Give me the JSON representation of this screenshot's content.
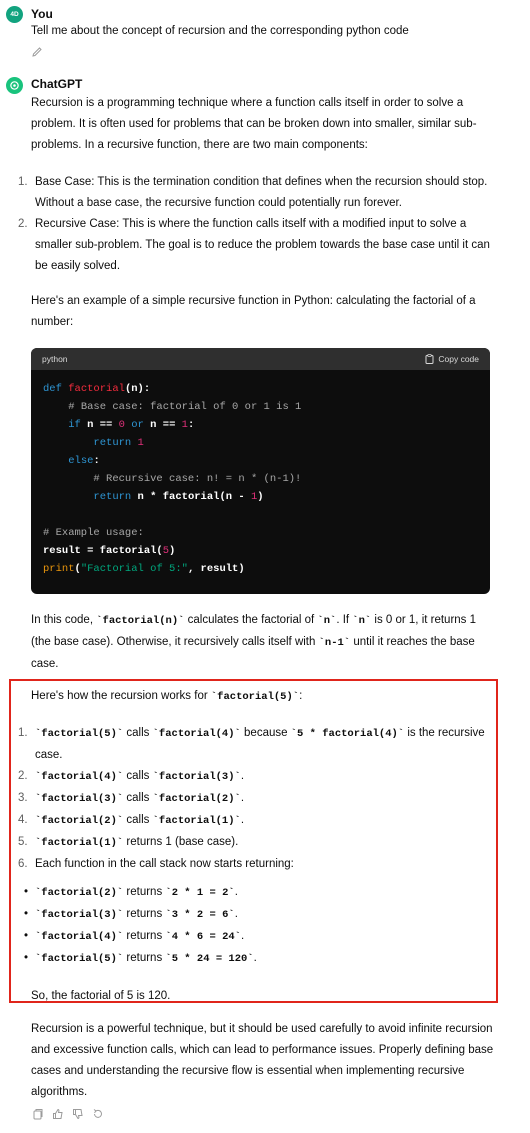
{
  "user": {
    "avatar_text": "4D",
    "name": "You",
    "message": "Tell me about the concept of recursion and the corresponding python code"
  },
  "assistant": {
    "name": "ChatGPT",
    "intro": "Recursion is a programming technique where a function calls itself in order to solve a problem. It is often used for problems that can be broken down into smaller, similar sub-problems. In a recursive function, there are two main components:",
    "components": [
      {
        "num": "1.",
        "text": "Base Case: This is the termination condition that defines when the recursion should stop. Without a base case, the recursive function could potentially run forever."
      },
      {
        "num": "2.",
        "text": "Recursive Case: This is where the function calls itself with a modified input to solve a smaller sub-problem. The goal is to reduce the problem towards the base case until it can be easily solved."
      }
    ],
    "example_intro": "Here's an example of a simple recursive function in Python: calculating the factorial of a number:",
    "code_block": {
      "language": "python",
      "copy_label": "Copy code"
    },
    "after_code": {
      "t1": "In this code, ",
      "c1": "`factorial(n)`",
      "t2": " calculates the factorial of ",
      "c2": "`n`",
      "t3": ". If ",
      "c3": "`n`",
      "t4": " is 0 or 1, it returns 1 (the base case). Otherwise, it recursively calls itself with ",
      "c4": "`n-1`",
      "t5": " until it reaches the base case."
    },
    "how_it_works": {
      "t1": "Here's how the recursion works for ",
      "c1": "`factorial(5)`",
      "t2": ":"
    },
    "trace_steps": [
      {
        "num": "1.",
        "c1": "`factorial(5)`",
        "t1": " calls ",
        "c2": "`factorial(4)`",
        "t2": " because ",
        "c3": "`5 * factorial(4)`",
        "t3": " is the recursive case."
      },
      {
        "num": "2.",
        "c1": "`factorial(4)`",
        "t1": " calls ",
        "c2": "`factorial(3)`",
        "t2": ".",
        "c3": "",
        "t3": ""
      },
      {
        "num": "3.",
        "c1": "`factorial(3)`",
        "t1": " calls ",
        "c2": "`factorial(2)`",
        "t2": ".",
        "c3": "",
        "t3": ""
      },
      {
        "num": "4.",
        "c1": "`factorial(2)`",
        "t1": " calls ",
        "c2": "`factorial(1)`",
        "t2": ".",
        "c3": "",
        "t3": ""
      },
      {
        "num": "5.",
        "c1": "`factorial(1)`",
        "t1": " returns 1 (base case).",
        "c2": "",
        "t2": "",
        "c3": "",
        "t3": ""
      },
      {
        "num": "6.",
        "c1": "",
        "t1": "Each function in the call stack now starts returning:",
        "c2": "",
        "t2": "",
        "c3": "",
        "t3": ""
      }
    ],
    "return_steps": [
      {
        "c1": "`factorial(2)`",
        "t1": " returns ",
        "c2": "`2 * 1 = 2`",
        "t2": "."
      },
      {
        "c1": "`factorial(3)`",
        "t1": " returns ",
        "c2": "`3 * 2 = 6`",
        "t2": "."
      },
      {
        "c1": "`factorial(4)`",
        "t1": " returns ",
        "c2": "`4 * 6 = 24`",
        "t2": "."
      },
      {
        "c1": "`factorial(5)`",
        "t1": " returns ",
        "c2": "`5 * 24 = 120`",
        "t2": "."
      }
    ],
    "conclusion": "So, the factorial of 5 is 120.",
    "closing": "Recursion is a powerful technique, but it should be used carefully to avoid infinite recursion and excessive function calls, which can lead to performance issues. Properly defining base cases and understanding the recursive flow is essential when implementing recursive algorithms."
  },
  "code": {
    "l1_def": "def ",
    "l1_fn": "factorial",
    "l1_rest": "(n):",
    "l2_cm": "# Base case: factorial of 0 or 1 is 1",
    "l3_if": "if",
    "l3_a": " n == ",
    "l3_0": "0",
    "l3_or": " or",
    "l3_b": " n == ",
    "l3_1": "1",
    "l3_c": ":",
    "l4_ret": "return ",
    "l4_1": "1",
    "l5_else": "else",
    "l5_c": ":",
    "l6_cm": "# Recursive case: n! = n * (n-1)!",
    "l7_ret": "return",
    "l7_a": " n * factorial(n - ",
    "l7_1": "1",
    "l7_b": ")",
    "l8_cm": "# Example usage:",
    "l9_a": "result = factorial(",
    "l9_5": "5",
    "l9_b": ")",
    "l10_print": "print",
    "l10_a": "(",
    "l10_str": "\"Factorial of 5:\"",
    "l10_b": ", result)"
  },
  "colors": {
    "highlight_border": "#e0251b",
    "code_bg": "#0d0d0d",
    "keyword": "#2e95d3",
    "function": "#f22c3d",
    "number": "#df3079",
    "string": "#00a67d"
  },
  "icons": {
    "edit": "pencil-icon",
    "copy": "clipboard-icon",
    "actions": [
      "copy-icon",
      "thumbs-up-icon",
      "thumbs-down-icon",
      "regenerate-icon"
    ]
  }
}
